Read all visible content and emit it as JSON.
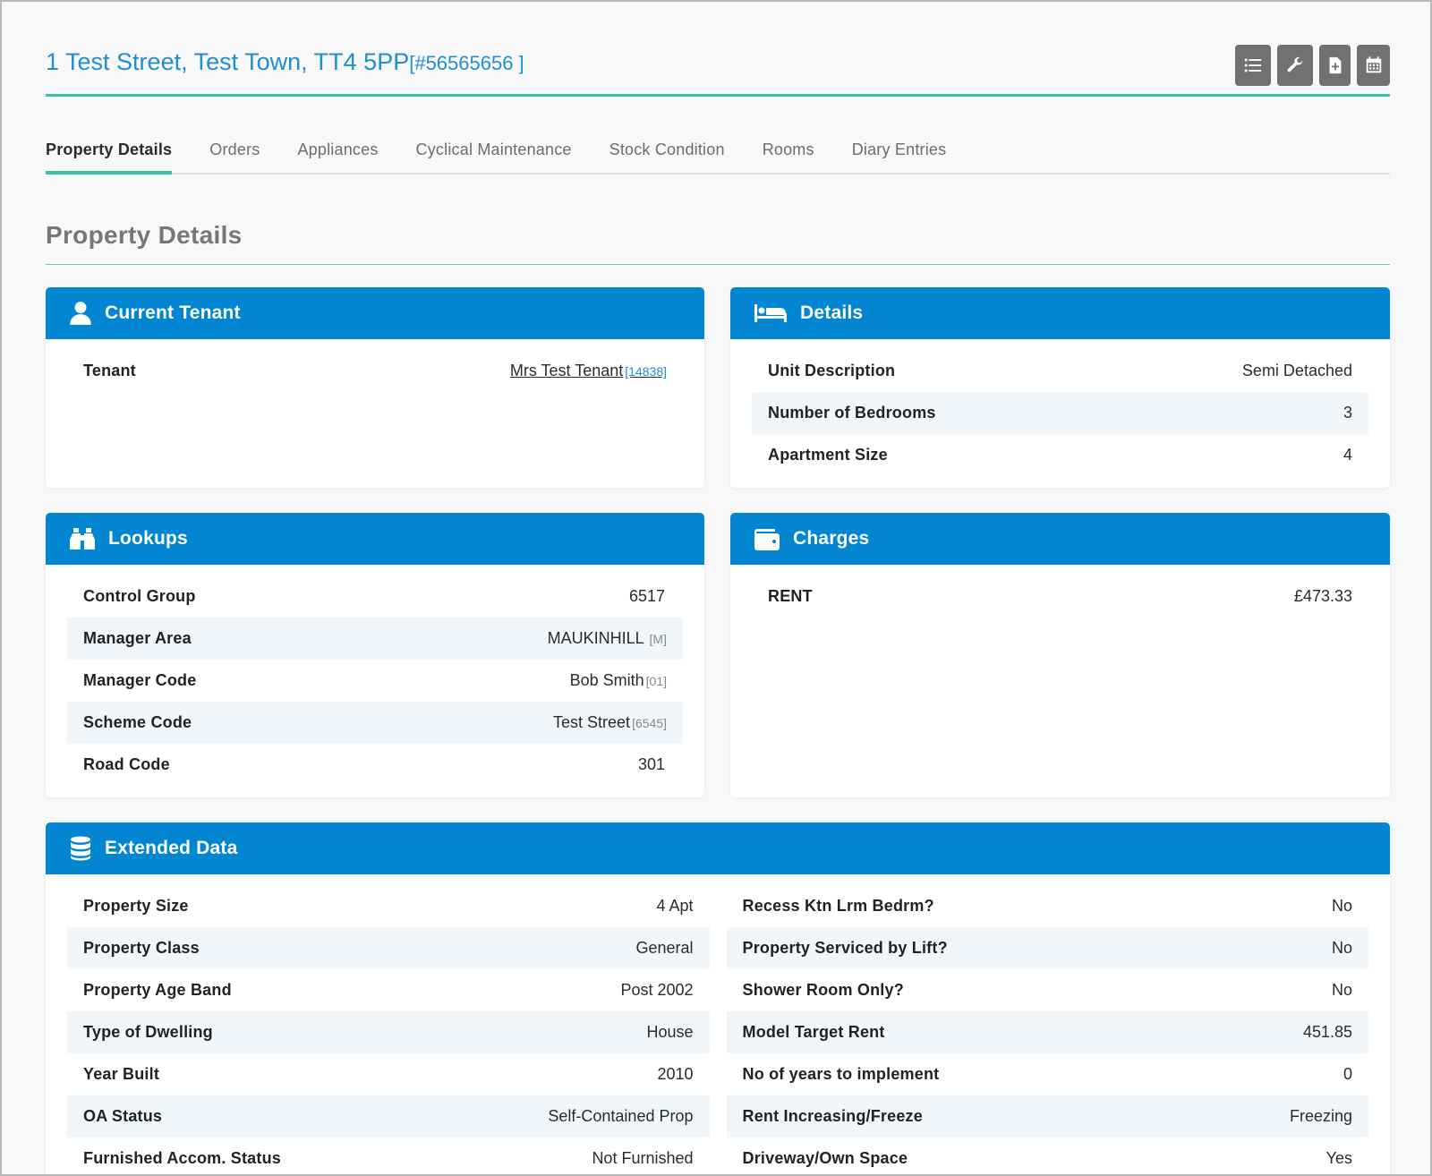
{
  "header": {
    "address": "1 Test Street, Test Town, TT4 5PP",
    "reference": "[#56565656 ]",
    "tools": [
      {
        "icon": "list-icon"
      },
      {
        "icon": "wrench-icon"
      },
      {
        "icon": "file-plus-icon"
      },
      {
        "icon": "calendar-icon"
      }
    ]
  },
  "tabs": [
    {
      "label": "Property Details",
      "active": true
    },
    {
      "label": "Orders"
    },
    {
      "label": "Appliances"
    },
    {
      "label": "Cyclical Maintenance"
    },
    {
      "label": "Stock Condition"
    },
    {
      "label": "Rooms"
    },
    {
      "label": "Diary Entries"
    }
  ],
  "section_title": "Property Details",
  "colors": {
    "accent": "#3dbfaa",
    "panel_header": "#0286d2",
    "link": "#1e8fcf"
  },
  "current_tenant": {
    "title": "Current Tenant",
    "icon": "user-icon",
    "tenant_label": "Tenant",
    "tenant_name": "Mrs Test Tenant",
    "tenant_code": "[14838]"
  },
  "details": {
    "title": "Details",
    "icon": "bed-icon",
    "rows": [
      {
        "label": "Unit Description",
        "value": "Semi Detached"
      },
      {
        "label": "Number of Bedrooms",
        "value": "3"
      },
      {
        "label": "Apartment Size",
        "value": "4"
      }
    ]
  },
  "lookups": {
    "title": "Lookups",
    "icon": "binoculars-icon",
    "rows": [
      {
        "label": "Control Group",
        "value": "6517",
        "code": ""
      },
      {
        "label": "Manager Area",
        "value": "MAUKINHILL",
        "code": " [M]"
      },
      {
        "label": "Manager Code",
        "value": "Bob Smith",
        "code": "[01]"
      },
      {
        "label": "Scheme Code",
        "value": "Test Street",
        "code": "[6545]"
      },
      {
        "label": "Road Code",
        "value": "301",
        "code": ""
      }
    ]
  },
  "charges": {
    "title": "Charges",
    "icon": "wallet-icon",
    "rows": [
      {
        "label": "RENT",
        "value": "£473.33"
      }
    ]
  },
  "extended": {
    "title": "Extended Data",
    "icon": "database-icon",
    "left": [
      {
        "label": "Property Size",
        "value": "4 Apt"
      },
      {
        "label": "Property Class",
        "value": "General"
      },
      {
        "label": "Property Age Band",
        "value": "Post 2002"
      },
      {
        "label": "Type of Dwelling",
        "value": "House"
      },
      {
        "label": "Year Built",
        "value": "2010"
      },
      {
        "label": "OA Status",
        "value": "Self-Contained Prop"
      },
      {
        "label": "Furnished Accom. Status",
        "value": "Not Furnished"
      }
    ],
    "right": [
      {
        "label": "Recess Ktn Lrm Bedrm?",
        "value": "No"
      },
      {
        "label": "Property Serviced by Lift?",
        "value": "No"
      },
      {
        "label": "Shower Room Only?",
        "value": "No"
      },
      {
        "label": "Model Target Rent",
        "value": "451.85"
      },
      {
        "label": "No of years to implement",
        "value": "0"
      },
      {
        "label": "Rent Increasing/Freeze",
        "value": "Freezing"
      },
      {
        "label": "Driveway/Own Space",
        "value": "Yes"
      }
    ]
  }
}
